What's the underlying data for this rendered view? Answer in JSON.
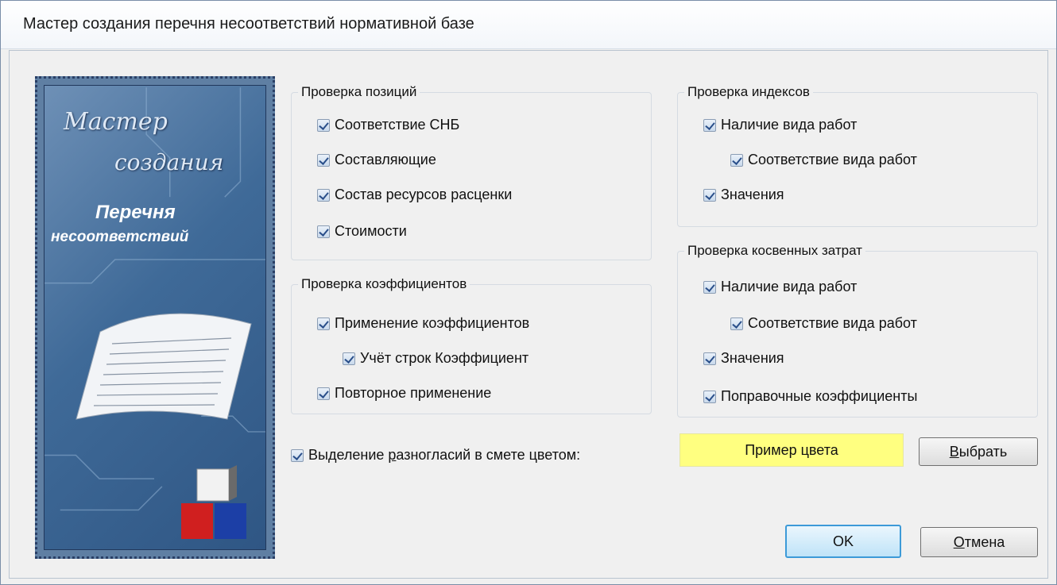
{
  "window": {
    "title": "Мастер создания перечня несоответствий нормативной базе"
  },
  "banner": {
    "line1": "Мастер",
    "line2": "создания",
    "line3": "Перечня",
    "line4": "несоответствий"
  },
  "groups": {
    "positions": {
      "title": "Проверка позиций",
      "items": [
        "Соответствие СНБ",
        "Составляющие",
        "Состав ресурсов расценки",
        "Стоимости"
      ]
    },
    "coefficients": {
      "title": "Проверка коэффициентов",
      "items": [
        "Применение коэффициентов",
        "Учёт строк Коэффициент",
        "Повторное применение"
      ]
    },
    "indexes": {
      "title": "Проверка индексов",
      "items": [
        "Наличие вида работ",
        "Соответствие вида работ",
        "Значения"
      ]
    },
    "indirect": {
      "title": "Проверка косвенных затрат",
      "items": [
        "Наличие вида работ",
        "Соответствие вида работ",
        "Значения",
        "Поправочные коэффициенты"
      ]
    }
  },
  "highlight": {
    "label_pre": "Выделение ",
    "label_mnemonic": "р",
    "label_post": "азногласий в смете цветом:",
    "swatch_text": "Пример цвета",
    "swatch_color": "#ffff80"
  },
  "buttons": {
    "choose_mnemonic": "В",
    "choose_rest": "ыбрать",
    "ok": "OK",
    "cancel_mnemonic": "О",
    "cancel_rest": "тмена"
  },
  "icons": {
    "checkbox": "checkmark-icon"
  }
}
